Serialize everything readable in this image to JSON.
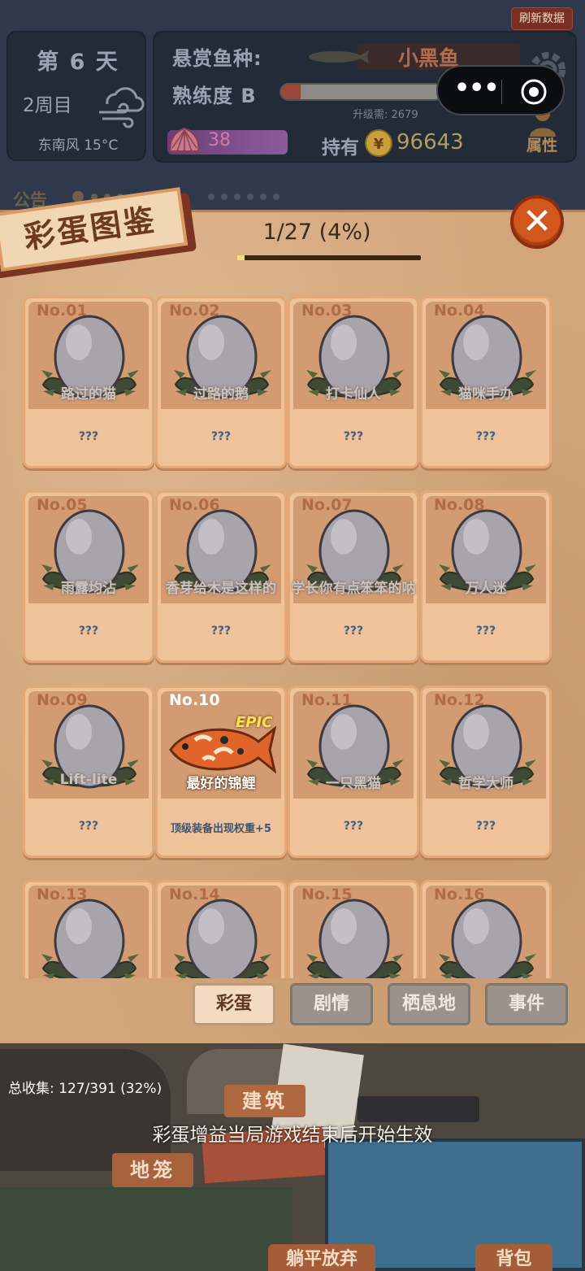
{
  "header": {
    "refresh_label": "刷新数据",
    "day": "第 6 天",
    "round": "2周目",
    "wind": "东南风 15°C",
    "bounty_label": "悬赏鱼种:",
    "bounty_fish": "小黑鱼",
    "proficiency_label": "熟练度 B",
    "proficiency_progress": 0.12,
    "upgrade_need": "升级需: 2679",
    "shells": "38",
    "hold_label": "持有",
    "coins": "96643",
    "attr_label": "属性",
    "notice_label": "公告"
  },
  "album": {
    "title": "彩蛋图鉴",
    "progress_text": "1/27 (4%)",
    "progress_value": 0.04,
    "close_symbol": "✕",
    "cards": [
      {
        "no": "No.01",
        "name": "路过的猫",
        "desc": "???",
        "unlocked": false
      },
      {
        "no": "No.02",
        "name": "过路的鹅",
        "desc": "???",
        "unlocked": false
      },
      {
        "no": "No.03",
        "name": "打卡仙人",
        "desc": "???",
        "unlocked": false
      },
      {
        "no": "No.04",
        "name": "猫咪手办",
        "desc": "???",
        "unlocked": false
      },
      {
        "no": "No.05",
        "name": "雨露均沾",
        "desc": "???",
        "unlocked": false
      },
      {
        "no": "No.06",
        "name": "香芽给木是这样的",
        "desc": "???",
        "unlocked": false
      },
      {
        "no": "No.07",
        "name": "学长你有点笨笨的呐",
        "desc": "???",
        "unlocked": false
      },
      {
        "no": "No.08",
        "name": "万人迷",
        "desc": "???",
        "unlocked": false
      },
      {
        "no": "No.09",
        "name": "Lift-lite",
        "desc": "???",
        "unlocked": false
      },
      {
        "no": "No.10",
        "name": "最好的锦鲤",
        "desc": "顶级装备出现权重+5",
        "unlocked": true,
        "badge": "EPIC"
      },
      {
        "no": "No.11",
        "name": "一只黑猫",
        "desc": "???",
        "unlocked": false
      },
      {
        "no": "No.12",
        "name": "哲学大师",
        "desc": "???",
        "unlocked": false
      },
      {
        "no": "No.13",
        "name": "",
        "desc": "",
        "unlocked": false
      },
      {
        "no": "No.14",
        "name": "",
        "desc": "",
        "unlocked": false
      },
      {
        "no": "No.15",
        "name": "",
        "desc": "",
        "unlocked": false
      },
      {
        "no": "No.16",
        "name": "",
        "desc": "",
        "unlocked": false
      }
    ],
    "tabs": [
      {
        "label": "彩蛋",
        "active": true
      },
      {
        "label": "剧情",
        "active": false
      },
      {
        "label": "栖息地",
        "active": false
      },
      {
        "label": "事件",
        "active": false
      }
    ]
  },
  "footer": {
    "total_collect": "总收集: 127/391 (32%)",
    "build_label": "建筑",
    "effect_note": "彩蛋增益当局游戏结束后开始生效",
    "cage_label": "地笼",
    "giveup_label": "躺平放弃",
    "bag_label": "背包"
  },
  "colors": {
    "panel": "#d3a57b",
    "card": "#efc29a",
    "accent": "#d2571e",
    "hud": "#232b39"
  }
}
